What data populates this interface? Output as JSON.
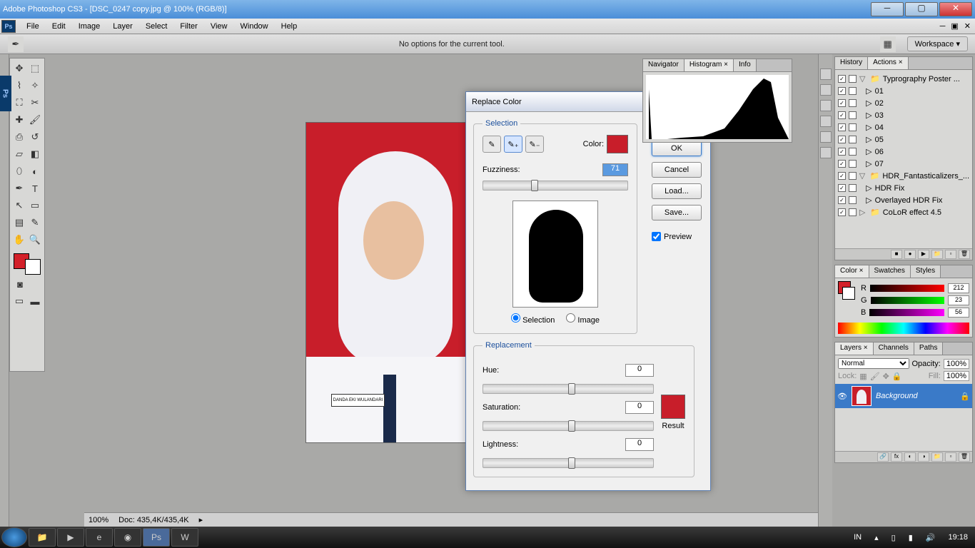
{
  "window": {
    "title": "Adobe Photoshop CS3 - [DSC_0247 copy.jpg @ 100% (RGB/8)]"
  },
  "menu": [
    "File",
    "Edit",
    "Image",
    "Layer",
    "Select",
    "Filter",
    "View",
    "Window",
    "Help"
  ],
  "options_bar": {
    "message": "No options for the current tool.",
    "workspace": "Workspace ▾"
  },
  "status": {
    "zoom": "100%",
    "doc": "Doc: 435,4K/435,4K"
  },
  "dialog": {
    "title": "Replace Color",
    "selection_legend": "Selection",
    "color_label": "Color:",
    "fuzziness_label": "Fuzziness:",
    "fuzziness_value": "71",
    "radio_selection": "Selection",
    "radio_image": "Image",
    "replacement_legend": "Replacement",
    "hue_label": "Hue:",
    "hue_value": "0",
    "sat_label": "Saturation:",
    "sat_value": "0",
    "light_label": "Lightness:",
    "light_value": "0",
    "result_label": "Result",
    "ok": "OK",
    "cancel": "Cancel",
    "load": "Load...",
    "save": "Save...",
    "preview": "Preview"
  },
  "nav_panel": {
    "tabs": [
      "Navigator",
      "Histogram ×",
      "Info"
    ]
  },
  "actions_panel": {
    "tabs": [
      "History",
      "Actions ×"
    ],
    "set1": "Typrography Poster ...",
    "items1": [
      "01",
      "02",
      "03",
      "04",
      "05",
      "06",
      "07"
    ],
    "set2": "HDR_Fantasticalizers_...",
    "items2": [
      "HDR Fix",
      "Overlayed HDR Fix"
    ],
    "set3": "CoLoR effect 4.5"
  },
  "color_panel": {
    "tabs": [
      "Color ×",
      "Swatches",
      "Styles"
    ],
    "r_label": "R",
    "r": "212",
    "g_label": "G",
    "g": "23",
    "b_label": "B",
    "b": "56"
  },
  "layers_panel": {
    "tabs": [
      "Layers ×",
      "Channels",
      "Paths"
    ],
    "mode": "Normal",
    "opacity_label": "Opacity:",
    "opacity": "100%",
    "lock_label": "Lock:",
    "fill_label": "Fill:",
    "fill": "100%",
    "layer_name": "Background"
  },
  "taskbar": {
    "lang": "IN",
    "time": "19:18"
  },
  "nametag": "DANDA EKI WULANDARI"
}
